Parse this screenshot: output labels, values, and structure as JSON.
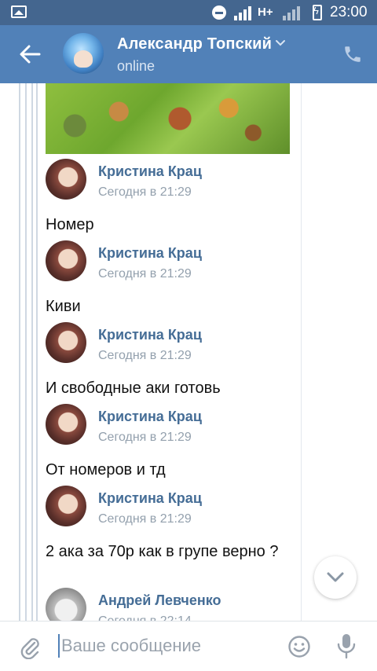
{
  "status_bar": {
    "time": "23:00",
    "network": "H+"
  },
  "header": {
    "title": "Александр Топский",
    "status": "online"
  },
  "messages": [
    {
      "author": "Кристина Крац",
      "time": "Сегодня в 21:29",
      "text": "Номер"
    },
    {
      "author": "Кристина Крац",
      "time": "Сегодня в 21:29",
      "text": "Киви"
    },
    {
      "author": "Кристина Крац",
      "time": "Сегодня в 21:29",
      "text": "И свободные аки готовь"
    },
    {
      "author": "Кристина Крац",
      "time": "Сегодня в 21:29",
      "text": "От номеров и тд"
    },
    {
      "author": "Кристина Крац",
      "time": "Сегодня в 21:29",
      "text": "2 ака за 70р  как в групе верно ?"
    },
    {
      "author": "Андрей Левченко",
      "time": "Сегодня в 22:14",
      "text": ""
    }
  ],
  "composer": {
    "placeholder": "Ваше сообщение"
  },
  "colors": {
    "status_bar": "#44668f",
    "header": "#5181b8",
    "author_name": "#456d96",
    "timestamp": "#93a0ad"
  },
  "icons": [
    "gallery-icon",
    "dnd-icon",
    "signal-icon",
    "battery-icon",
    "back-arrow-icon",
    "chevron-down-icon",
    "phone-icon",
    "scroll-down-icon",
    "paperclip-icon",
    "emoji-icon",
    "microphone-icon"
  ]
}
